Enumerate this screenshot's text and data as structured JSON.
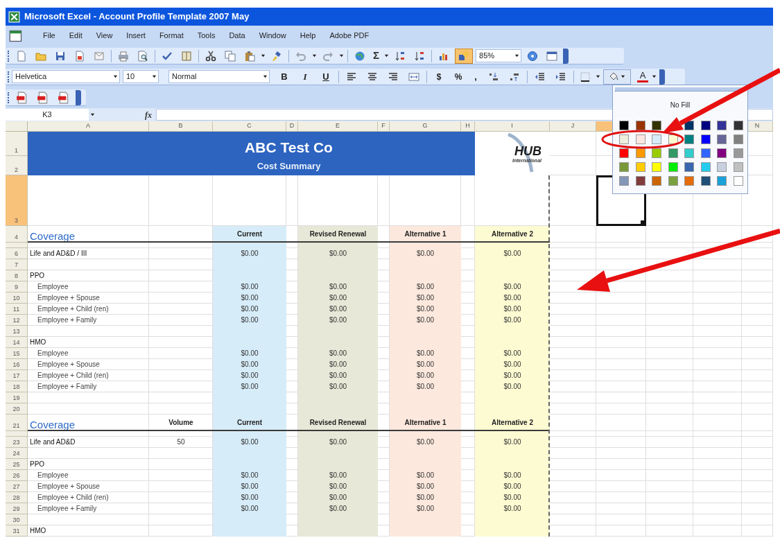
{
  "window": {
    "title": "Microsoft Excel - Account Profile Template 2007 May"
  },
  "menu": [
    "File",
    "Edit",
    "View",
    "Insert",
    "Format",
    "Tools",
    "Data",
    "Window",
    "Help",
    "Adobe PDF"
  ],
  "standard_toolbar": {
    "autosum": "Σ",
    "zoom": "85%"
  },
  "formatting_toolbar": {
    "font": "Helvetica",
    "size": "10",
    "style": "Normal",
    "bold": "B",
    "italic": "I",
    "underline": "U",
    "currency": "$",
    "percent": "%",
    "comma": ",",
    "font_color": "A"
  },
  "formula_bar": {
    "name_box": "K3",
    "function_label": "fx"
  },
  "sheet": {
    "columns": {
      "A": {
        "label": "A",
        "selected": false
      },
      "B": {
        "label": "B",
        "selected": false
      },
      "C": {
        "label": "C",
        "selected": false,
        "color": "#d6ecf8"
      },
      "D": {
        "label": "D",
        "selected": false
      },
      "E": {
        "label": "E",
        "selected": false,
        "color": "#e8e8d8"
      },
      "F": {
        "label": "F",
        "selected": false
      },
      "G": {
        "label": "G",
        "selected": false,
        "color": "#fce8dd"
      },
      "H": {
        "label": "H",
        "selected": false
      },
      "I": {
        "label": "I",
        "selected": false,
        "color": "#fdfbd2"
      },
      "J": {
        "label": "J",
        "selected": false
      },
      "K": {
        "selected": true
      },
      "N": {
        "label": "N",
        "selected": false
      }
    },
    "banner": {
      "title": "ABC Test Co",
      "subtitle": "Cost Summary"
    },
    "logo": {
      "name": "HUB",
      "tagline": "International"
    },
    "rows": [
      {
        "number": "1",
        "kind": "title",
        "selected": false
      },
      {
        "number": "2",
        "kind": "subtitle",
        "selected": false
      },
      {
        "number": "3",
        "kind": "tall",
        "selected": true
      },
      {
        "number": "4",
        "kind": "section",
        "selected": false,
        "cells": {
          "A": "Coverage",
          "C": "Current",
          "E": "Revised Renewal",
          "G": "Alternative 1",
          "I": "Alternative 2"
        }
      },
      {
        "kind": "collapsed",
        "selected": false
      },
      {
        "number": "6",
        "kind": "item",
        "selected": false,
        "cells": {
          "A": "Life and AD&D / III",
          "C": "$0.00",
          "E": "$0.00",
          "G": "$0.00",
          "I": "$0.00"
        }
      },
      {
        "number": "7",
        "kind": "blank",
        "selected": false
      },
      {
        "number": "8",
        "kind": "item",
        "selected": false,
        "cells": {
          "A": "PPO"
        }
      },
      {
        "number": "9",
        "kind": "subitem",
        "selected": false,
        "cells": {
          "A": "Employee",
          "C": "$0.00",
          "E": "$0.00",
          "G": "$0.00",
          "I": "$0.00"
        }
      },
      {
        "number": "10",
        "kind": "subitem",
        "selected": false,
        "cells": {
          "A": "Employee + Spouse",
          "C": "$0.00",
          "E": "$0.00",
          "G": "$0.00",
          "I": "$0.00"
        }
      },
      {
        "number": "11",
        "kind": "subitem",
        "selected": false,
        "cells": {
          "A": "Employee + Child (ren)",
          "C": "$0.00",
          "E": "$0.00",
          "G": "$0.00",
          "I": "$0.00"
        }
      },
      {
        "number": "12",
        "kind": "subitem",
        "selected": false,
        "cells": {
          "A": "Employee + Family",
          "C": "$0.00",
          "E": "$0.00",
          "G": "$0.00",
          "I": "$0.00"
        }
      },
      {
        "number": "13",
        "kind": "blank",
        "selected": false
      },
      {
        "number": "14",
        "kind": "item",
        "selected": false,
        "cells": {
          "A": "HMO"
        }
      },
      {
        "number": "15",
        "kind": "subitem",
        "selected": false,
        "cells": {
          "A": "Employee",
          "C": "$0.00",
          "E": "$0.00",
          "G": "$0.00",
          "I": "$0.00"
        }
      },
      {
        "number": "16",
        "kind": "subitem",
        "selected": false,
        "cells": {
          "A": "Employee + Spouse",
          "C": "$0.00",
          "E": "$0.00",
          "G": "$0.00",
          "I": "$0.00"
        }
      },
      {
        "number": "17",
        "kind": "subitem",
        "selected": false,
        "cells": {
          "A": "Employee + Child (ren)",
          "C": "$0.00",
          "E": "$0.00",
          "G": "$0.00",
          "I": "$0.00"
        }
      },
      {
        "number": "18",
        "kind": "subitem",
        "selected": false,
        "cells": {
          "A": "Employee + Family",
          "C": "$0.00",
          "E": "$0.00",
          "G": "$0.00",
          "I": "$0.00"
        }
      },
      {
        "number": "19",
        "kind": "blank",
        "selected": false
      },
      {
        "number": "20",
        "kind": "blank",
        "selected": false
      },
      {
        "number": "21",
        "kind": "section",
        "selected": false,
        "cells": {
          "A": "Coverage",
          "B": "Volume",
          "C": "Current",
          "E": "Revised Renewal",
          "G": "Alternative 1",
          "I": "Alternative 2"
        }
      },
      {
        "kind": "collapsed",
        "selected": false
      },
      {
        "number": "23",
        "kind": "item",
        "selected": false,
        "cells": {
          "A": "Life and AD&D",
          "B": "50",
          "C": "$0.00",
          "E": "$0.00",
          "G": "$0.00",
          "I": "$0.00"
        }
      },
      {
        "number": "24",
        "kind": "blank",
        "selected": false
      },
      {
        "number": "25",
        "kind": "item",
        "selected": false,
        "cells": {
          "A": "PPO"
        }
      },
      {
        "number": "26",
        "kind": "subitem",
        "selected": false,
        "cells": {
          "A": "Employee",
          "C": "$0.00",
          "E": "$0.00",
          "G": "$0.00",
          "I": "$0.00"
        }
      },
      {
        "number": "27",
        "kind": "subitem",
        "selected": false,
        "cells": {
          "A": "Employee + Spouse",
          "C": "$0.00",
          "E": "$0.00",
          "G": "$0.00",
          "I": "$0.00"
        }
      },
      {
        "number": "28",
        "kind": "subitem",
        "selected": false,
        "cells": {
          "A": "Employee + Child (ren)",
          "C": "$0.00",
          "E": "$0.00",
          "G": "$0.00",
          "I": "$0.00"
        }
      },
      {
        "number": "29",
        "kind": "subitem",
        "selected": false,
        "cells": {
          "A": "Employee + Family",
          "C": "$0.00",
          "E": "$0.00",
          "G": "$0.00",
          "I": "$0.00"
        }
      },
      {
        "number": "30",
        "kind": "blank",
        "selected": false
      },
      {
        "number": "31",
        "kind": "item",
        "selected": false,
        "cells": {
          "A": "HMO"
        }
      }
    ]
  },
  "fill_palette": {
    "no_fill": "No Fill",
    "swatches": [
      {
        "color": "#000000"
      },
      {
        "color": "#993300"
      },
      {
        "color": "#333300"
      },
      {
        "kind": "covered"
      },
      {
        "color": "#003366"
      },
      {
        "color": "#000080"
      },
      {
        "color": "#333399"
      },
      {
        "color": "#333333"
      },
      {
        "color": "#eeeedd"
      },
      {
        "color": "#fbe6e0"
      },
      {
        "color": "#d6ecf8"
      },
      {
        "color": "#fdfbd0"
      },
      {
        "color": "#008080"
      },
      {
        "color": "#0000ff"
      },
      {
        "color": "#666699"
      },
      {
        "color": "#808080"
      },
      {
        "color": "#ff0000"
      },
      {
        "color": "#ff9900"
      },
      {
        "color": "#99cc00"
      },
      {
        "color": "#339966"
      },
      {
        "color": "#33cccc"
      },
      {
        "color": "#3366ff"
      },
      {
        "color": "#800080"
      },
      {
        "color": "#999999"
      },
      {
        "color": "#7a9a3a"
      },
      {
        "color": "#ffcc00"
      },
      {
        "color": "#ffff00"
      },
      {
        "color": "#00ee00"
      },
      {
        "color": "#3a66b0"
      },
      {
        "color": "#22ccee"
      },
      {
        "color": "#c8d0e0"
      },
      {
        "color": "#c0c0c0"
      },
      {
        "color": "#8496b8"
      },
      {
        "color": "#833c3c"
      },
      {
        "color": "#cc6600"
      },
      {
        "color": "#7aa040"
      },
      {
        "color": "#e46c0a"
      },
      {
        "color": "#1f4e79"
      },
      {
        "color": "#1ba1d8"
      },
      {
        "color": "#ffffff"
      }
    ]
  }
}
